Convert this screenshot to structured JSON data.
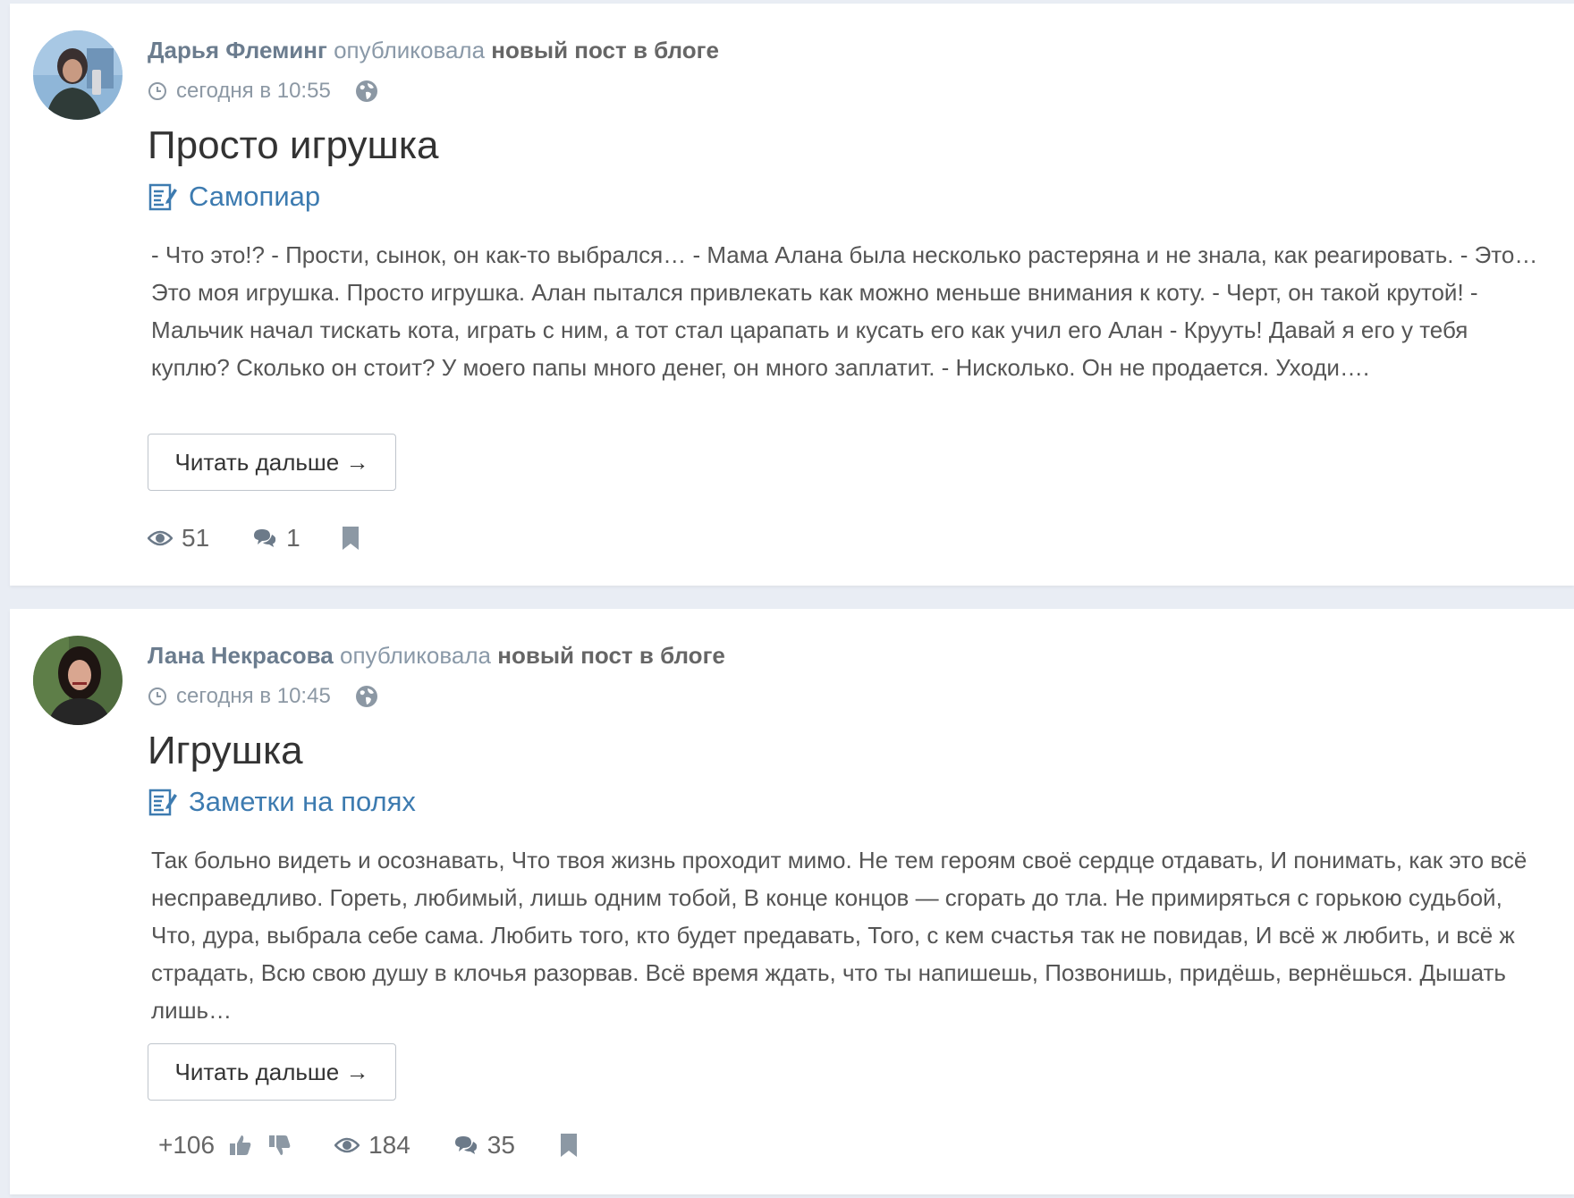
{
  "posts": [
    {
      "author": "Дарья Флеминг",
      "action": "опубликовала",
      "target": "новый пост в блоге",
      "time": "сегодня в 10:55",
      "title": "Просто игрушка",
      "blog": "Самопиар",
      "excerpt": "- Что это!? - Прости, сынок, он как-то выбрался… - Мама Алана была несколько растеряна и не знала, как реаги­ровать. - Это… Это моя игрушка. Просто игрушка. Алан пытался привлекать как можно меньше внимания к коту. - Черт, он такой крутой! - Мальчик начал тискать кота, играть с ним, а тот стал царапать и кусать его как учил его Алан - Крууть! Давай я его у тебя куплю? Сколько он стоит? У моего папы много денег, он много заплатит. - Ни­сколько. Он не продается. Уходи….",
      "read_more": "Читать дальше →",
      "views": "51",
      "comments": "1"
    },
    {
      "author": "Лана Некрасова",
      "action": "опубликовала",
      "target": "новый пост в блоге",
      "time": "сегодня в 10:45",
      "title": "Игрушка",
      "blog": "Заметки на полях",
      "excerpt": "Так больно видеть и осознавать, Что твоя жизнь проходит мимо. Не тем героям своё сердце отдавать, И пони­мать, как это всё несправедливо. Гореть, любимый, лишь одним тобой, В конце концов — сгорать до тла. Не при­миряться с горькою судьбой, Что, дура, выбрала себе сама. Любить того, кто будет предавать, Того, с кем сча­стья так не повидав, И всё ж любить, и всё ж страдать, Всю свою душу в клочья разорвав. Всё время ждать, что ты напишешь, Позвонишь, придёшь, вернёшься. Дышать лишь…",
      "read_more": "Читать дальше →",
      "rating": "+106",
      "views": "184",
      "comments": "35"
    }
  ],
  "colors": {
    "author": "#6b7c8e",
    "blog_link": "#3d7bb0",
    "icon": "#6c7a89",
    "background": "#e9edf4"
  },
  "icons": [
    "clock-icon",
    "globe-icon",
    "blog-icon",
    "eye-icon",
    "comments-icon",
    "bookmark-icon",
    "thumbs-up-icon",
    "thumbs-down-icon"
  ]
}
